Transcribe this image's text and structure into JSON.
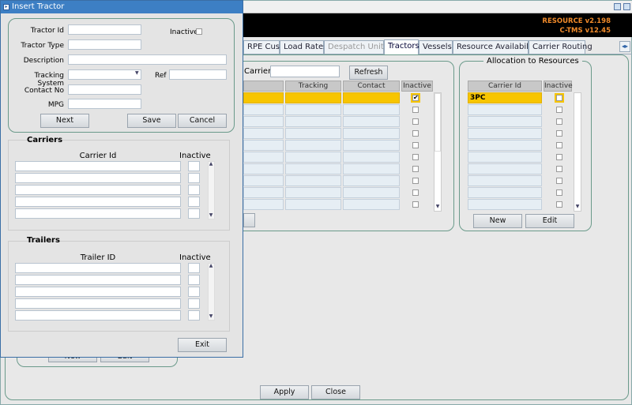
{
  "dialog": {
    "title": "Insert Tractor",
    "fields": {
      "tractor_id_label": "Tractor Id",
      "tractor_type_label": "Tractor Type",
      "description_label": "Description",
      "tracking_system_label": "Tracking System",
      "ref_label": "Ref",
      "contact_no_label": "Contact No",
      "mpg_label": "MPG",
      "inactive_label": "Inactive",
      "tractor_id_value": "",
      "tractor_type_value": "",
      "description_value": "",
      "tracking_system_value": "",
      "ref_value": "",
      "contact_no_value": "",
      "mpg_value": ""
    },
    "buttons": {
      "next": "Next",
      "save": "Save",
      "cancel": "Cancel",
      "exit": "Exit"
    },
    "carriers": {
      "title": "Carriers",
      "col_id": "Carrier Id",
      "col_inactive": "Inactive"
    },
    "trailers": {
      "title": "Trailers",
      "col_id": "Trailer ID",
      "col_inactive": "Inactive"
    }
  },
  "main": {
    "banner": {
      "resource": "RESOURCE v2.198",
      "ctms": "C-TMS v12.45"
    },
    "tabs": [
      "RPE Cust",
      "Load Rates",
      "Despatch Units",
      "Tractors",
      "Vessels",
      "Resource Availability",
      "Carrier Routing"
    ],
    "active_tab": "Tractors",
    "filter": {
      "carrier_label": "Carrier",
      "carrier_value": "",
      "refresh": "Refresh"
    },
    "grid": {
      "col_tracking": "Tracking",
      "col_contact": "Contact",
      "col_inactive": "Inactive"
    },
    "allocation": {
      "title": "Allocation to Resources",
      "col_carrier": "Carrier Id",
      "col_inactive": "Inactive",
      "rows": [
        "3PC",
        "",
        "",
        "",
        "",
        "",
        "",
        "",
        "",
        ""
      ],
      "new": "New",
      "edit": "Edit"
    },
    "hidden_buttons": {
      "new": "New",
      "edit": "Edit"
    },
    "footer": {
      "apply": "Apply",
      "close": "Close"
    }
  },
  "colors": {
    "selected_row": "#f7c500",
    "title_blue": "#3d7fc4",
    "banner_text": "#f08a2a"
  }
}
